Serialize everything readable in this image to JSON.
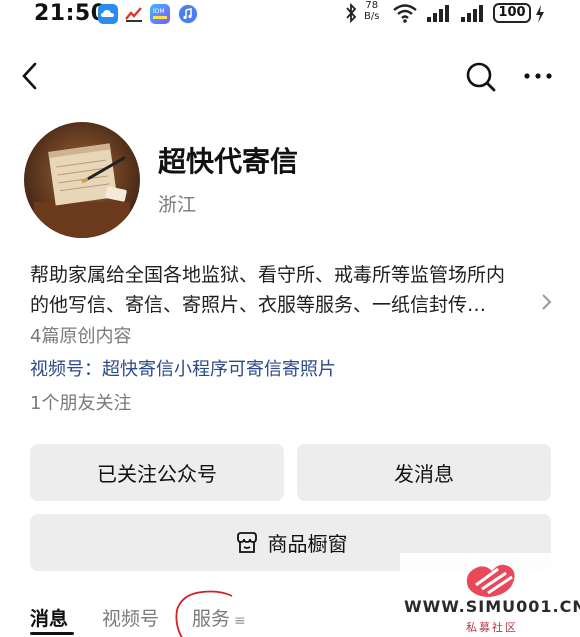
{
  "status_bar": {
    "time": "21:50",
    "network_speed_value": "78",
    "network_speed_unit": "B/s",
    "battery": "100"
  },
  "nav": {
    "back_icon": "chevron-left-icon",
    "search_icon": "search-icon",
    "more_icon": "more-horizontal-icon"
  },
  "profile": {
    "name": "超快代寄信",
    "region": "浙江",
    "description_line1": "帮助家属给全国各地监狱、看守所、戒毒所等监管场所内",
    "description_line2": "的他写信、寄信、寄照片、衣服等服务、一纸信封传…",
    "original_count": "4篇原创内容",
    "video_account": "视频号：超快寄信小程序可寄信寄照片",
    "friends_follow": "1个朋友关注"
  },
  "actions": {
    "followed_label": "已关注公众号",
    "message_label": "发消息",
    "shop_label": "商品橱窗"
  },
  "tabs": [
    {
      "label": "消息"
    },
    {
      "label": "视频号"
    },
    {
      "label": "服务"
    }
  ],
  "watermark": {
    "text": "WWW.SIMU001.CN",
    "sub": "私募社区"
  },
  "colors": {
    "link": "#2c4a8a",
    "button_bg": "#ededed",
    "annotation_red": "#d42020"
  }
}
